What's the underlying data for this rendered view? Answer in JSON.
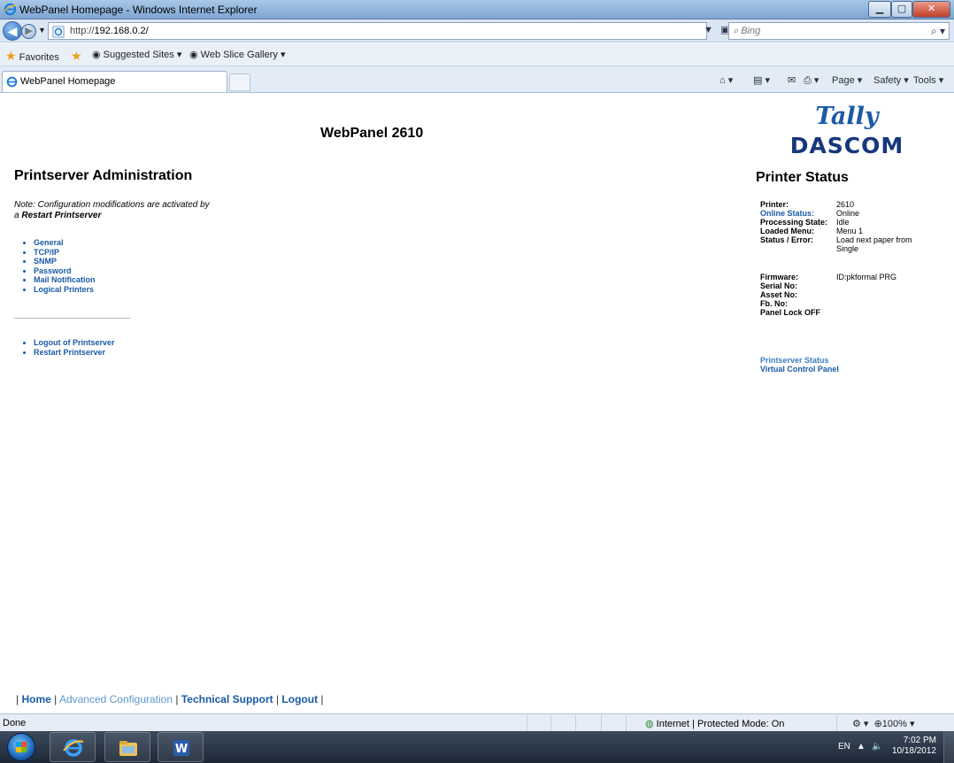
{
  "window": {
    "title": "WebPanel Homepage - Windows Internet Explorer"
  },
  "addressbar": {
    "url_prefix": "http://",
    "url_host": "192.168.0.2/",
    "search_placeholder": "Bing"
  },
  "favorites": {
    "favorites_label": "Favorites",
    "suggested_sites": "Suggested Sites ▾",
    "web_slice_gallery": "Web Slice Gallery ▾"
  },
  "tabs": {
    "active_tab_label": "WebPanel Homepage"
  },
  "commandbar": {
    "page_label": "Page ▾",
    "safety_label": "Safety ▾",
    "tools_label": "Tools ▾"
  },
  "page": {
    "heading": "WebPanel 2610",
    "logo_line1": "Tally",
    "logo_line2": "DASCOM",
    "admin_title": "Printserver Administration",
    "note_prefix": "Note: Configuration modifications are activated by",
    "note_article": "a ",
    "note_emphasis": "Restart Printserver",
    "menu_items": [
      "General",
      "TCP/IP",
      "SNMP",
      "Password",
      "Mail Notification",
      "Logical Printers"
    ],
    "action_items": [
      "Logout of Printserver",
      "Restart Printserver"
    ]
  },
  "printer_status": {
    "title": "Printer Status",
    "rows": [
      {
        "key": "Printer:",
        "value": "2610"
      },
      {
        "key": "Online Status:",
        "value": "Online"
      },
      {
        "key": "Processing State:",
        "value": "Idle"
      },
      {
        "key": "Loaded Menu:",
        "value": "Menu 1"
      },
      {
        "key": "Status / Error:",
        "value": "Load next paper from Single"
      }
    ],
    "rows2": [
      {
        "key": "Firmware:",
        "value": "ID:pkformal PRG"
      },
      {
        "key": "Serial No:",
        "value": ""
      },
      {
        "key": "Asset No:",
        "value": ""
      },
      {
        "key": "Fb. No:",
        "value": ""
      },
      {
        "key": "Panel Lock OFF",
        "value": ""
      }
    ],
    "links": [
      "Printserver Status",
      "Virtual Control Panel"
    ]
  },
  "footer": {
    "home": "Home",
    "advanced": "Advanced Configuration",
    "support": "Technical Support",
    "logout": "Logout"
  },
  "statusbar": {
    "left": "Done",
    "zone": "Internet | Protected Mode: On",
    "zoom": "100%"
  },
  "taskbar": {
    "language": "EN",
    "time": "7:02 PM",
    "date": "10/18/2012"
  },
  "colors": {
    "link_blue": "#1a5aa5",
    "light_link_blue": "#5b98d0",
    "logo_blue": "#16377c"
  }
}
